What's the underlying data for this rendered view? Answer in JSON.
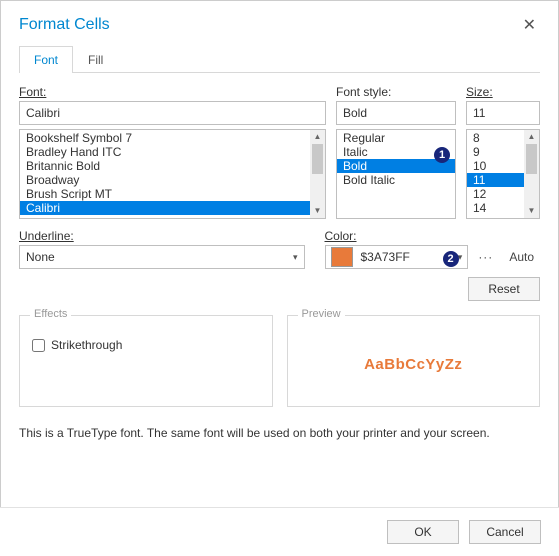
{
  "dialog": {
    "title": "Format Cells"
  },
  "tabs": {
    "font": "Font",
    "fill": "Fill"
  },
  "labels": {
    "font": "Font:",
    "style": "Font style:",
    "size": "Size:",
    "underline": "Underline:",
    "color": "Color:"
  },
  "font": {
    "value": "Calibri",
    "list": [
      "Bookshelf Symbol 7",
      "Bradley Hand ITC",
      "Britannic Bold",
      "Broadway",
      "Brush Script MT",
      "Calibri"
    ],
    "selected": "Calibri"
  },
  "style": {
    "value": "Bold",
    "list": [
      "Regular",
      "Italic",
      "Bold",
      "Bold Italic"
    ],
    "selected": "Bold"
  },
  "size": {
    "value": "11",
    "list": [
      "8",
      "9",
      "10",
      "11",
      "12",
      "14"
    ],
    "selected": "11"
  },
  "underline": {
    "value": "None"
  },
  "color": {
    "hex": "$3A73FF",
    "auto": "Auto",
    "swatch": "#e87a3a"
  },
  "buttons": {
    "reset": "Reset",
    "ok": "OK",
    "cancel": "Cancel"
  },
  "groups": {
    "effects": "Effects",
    "preview": "Preview",
    "strikethrough": "Strikethrough"
  },
  "preview": {
    "text": "AaBbCcYyZz"
  },
  "note": "This is a TrueType font. The same font will be used on both your printer and your screen.",
  "badges": {
    "one": "1",
    "two": "2"
  },
  "icons": {
    "close": "✕",
    "caret": "▾",
    "dots": "···",
    "up": "▲",
    "down": "▼"
  }
}
